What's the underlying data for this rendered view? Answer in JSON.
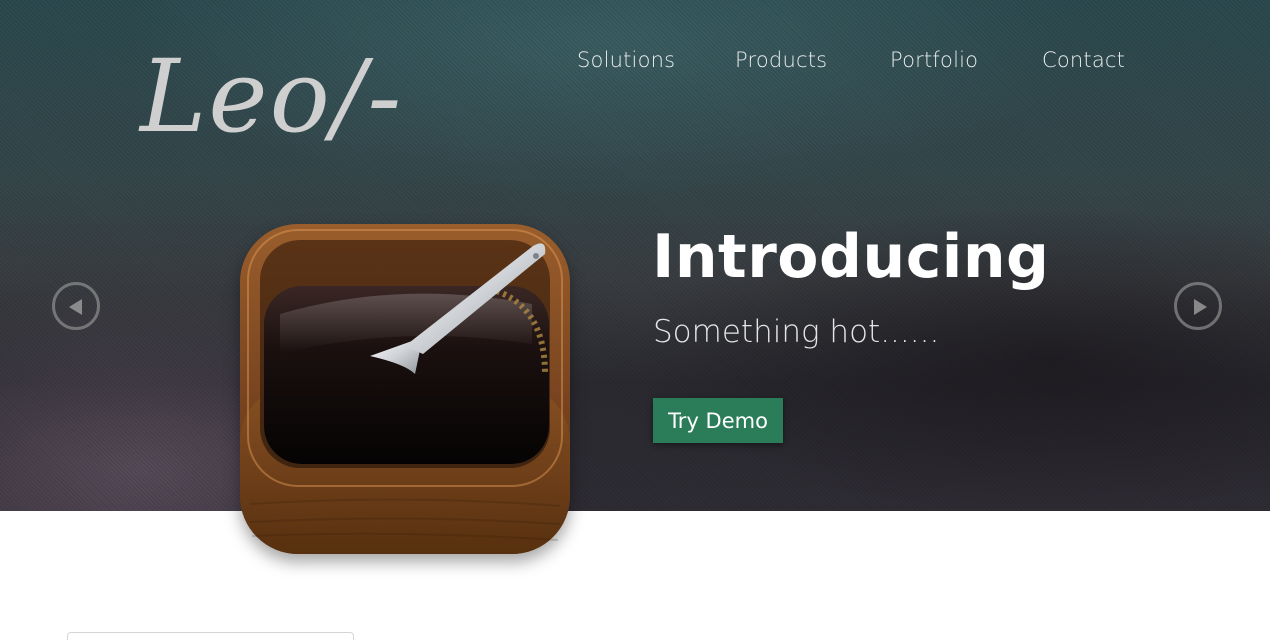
{
  "header": {
    "logo_text": "Leo/-",
    "nav": [
      {
        "label": "Solutions"
      },
      {
        "label": "Products"
      },
      {
        "label": "Portfolio"
      },
      {
        "label": "Contact"
      }
    ]
  },
  "hero": {
    "headline": "Introducing",
    "subheadline": "Something hot......",
    "cta_label": "Try Demo",
    "image": "coffee-app-icon",
    "prev_icon": "chevron-left-icon",
    "next_icon": "chevron-right-icon"
  },
  "colors": {
    "accent": "#2a7d58",
    "hero_background": "#34484c",
    "logo": "#cfcfcf",
    "text": "#ffffff"
  }
}
